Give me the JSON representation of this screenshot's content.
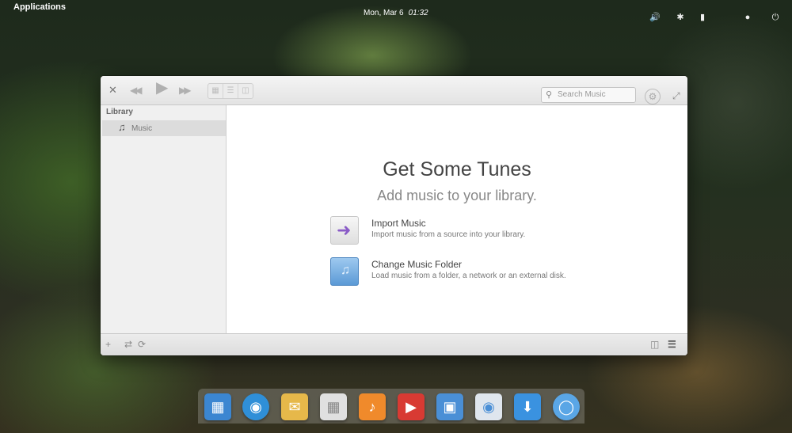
{
  "panel": {
    "applications_label": "Applications",
    "date": "Mon, Mar 6",
    "time": "01:32"
  },
  "window": {
    "search_placeholder": "Search Music",
    "sidebar": {
      "header": "Library",
      "items": [
        {
          "label": "Music",
          "icon": "music-note-icon"
        }
      ]
    },
    "welcome": {
      "title": "Get Some Tunes",
      "subtitle": "Add music to your library.",
      "actions": [
        {
          "title": "Import Music",
          "description": "Import music from a source into your library.",
          "icon": "import-arrow-icon"
        },
        {
          "title": "Change Music Folder",
          "description": "Load music from a folder, a network or an external disk.",
          "icon": "music-folder-icon"
        }
      ]
    }
  },
  "dock": {
    "apps": [
      {
        "name": "multitasking-view",
        "color": "#3b86d1"
      },
      {
        "name": "web-browser",
        "color": "#2f8fd8"
      },
      {
        "name": "mail",
        "color": "#e6b84a"
      },
      {
        "name": "calendar",
        "color": "#e0e0e0"
      },
      {
        "name": "music",
        "color": "#f08a2b"
      },
      {
        "name": "videos",
        "color": "#d83a33"
      },
      {
        "name": "photos",
        "color": "#4a8fd6"
      },
      {
        "name": "system-settings",
        "color": "#dfe6ee"
      },
      {
        "name": "appcenter",
        "color": "#3a92e0"
      },
      {
        "name": "system-update",
        "color": "#5aa6e6"
      }
    ]
  }
}
